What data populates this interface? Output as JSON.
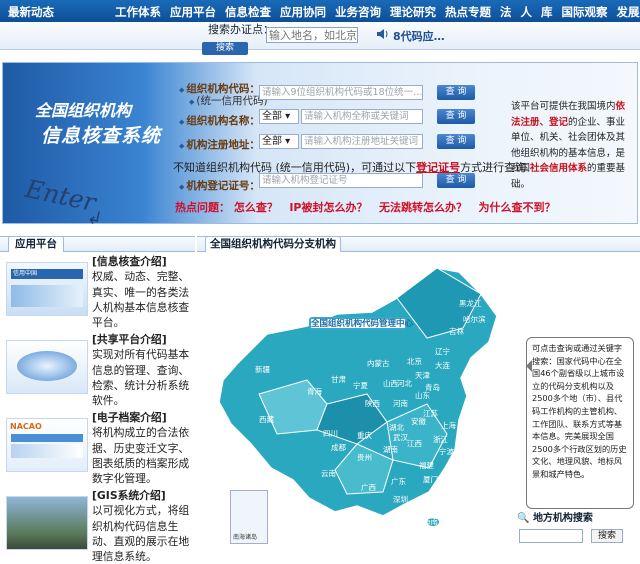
{
  "topnav": {
    "brand": "最新动态",
    "links": [
      "工作体系",
      "应用平台",
      "信息检查",
      "应用协同",
      "业务咨询",
      "理论研究",
      "热点专题",
      "法",
      "人",
      "库",
      "国际观察",
      "发展历程"
    ]
  },
  "notice": {
    "query_label": "搜索办证点：",
    "query_placeholder": "输入地名，如北京",
    "query_button": "搜索",
    "speaker_text": "8代码应…"
  },
  "banner": {
    "title_line1": "全国组织机构",
    "title_line2": "信息核查系统",
    "enter": "Enter",
    "code_label": "组织机构代码：",
    "code_label2": "(统一信用代码)",
    "code_placeholder": "请输入9位组织机构代码或18位统一…",
    "name_label": "组织机构名称：",
    "name_scope": "全部",
    "name_placeholder": "请输入机构全称或关键词",
    "addr_label": "机构注册地址：",
    "addr_scope": "全部",
    "addr_placeholder": "请输入机构注册地址关键词",
    "query_button": "查 询",
    "hint_prefix": "不知道组织机构代码 (统一信用代码)，可通过以下",
    "hint_link": "登记证号",
    "hint_suffix": "方式进行查询",
    "reg_label": "机构登记证号：",
    "reg_placeholder": "请输入机构登记证号",
    "hot_label": "热点问题：",
    "hot_items": [
      "怎么查？",
      "IP被封怎么办？",
      "无法跳转怎么办？",
      "为什么查不到？"
    ],
    "side_part1": "该平台可提供在我国境内",
    "side_red1": "依法注册、登记",
    "side_part2": "的企业、事业单位、机关、社会团体及其他组织机构的基本信息，是我国",
    "side_red2": "社会信用体系",
    "side_part3": "的重要基础。"
  },
  "left_panel": {
    "tab": "应用平台",
    "items": [
      {
        "title": "[信息核查介绍]",
        "body": "权威、动态、完整、真实、唯一的各类法人机构基本信息核查平台。",
        "thumb_text": "信用中国"
      },
      {
        "title": "[共享平台介绍]",
        "body": "实现对所有代码基本信息的管理、查询、检索、统计分析系统软件。",
        "thumb_text": ""
      },
      {
        "title": "[电子档案介绍]",
        "body": "将机构成立的合法依据、历史变迁文字、图表纸质的档案形成数字化管理。",
        "thumb_text": "NACAO"
      },
      {
        "title": "[GIS系统介绍]",
        "body": "以可视化方式，将组织机构代码信息生动、直观的展示在地理信息系统。",
        "thumb_text": ""
      }
    ]
  },
  "right_panel": {
    "tab": "全国组织机构代码分支机构",
    "center_label": "全国组织机构代码管理中心",
    "bubble": "可点击查询或通过关键字搜索：国家代码中心在全国46个副省级以上城市设立的代码分支机构以及2500多个地（市）、县代码工作机构的主管机构、工作团队、联系方式等基本信息。完美展现全国2500多个行政区划的历史文化、地理风貌、地标风景和城产特色。",
    "geo_search": "地方机构搜索",
    "geo_button": "搜索",
    "inset_label": "南海诸岛",
    "provinces": [
      "黑龙江",
      "吉林",
      "辽宁",
      "北京",
      "天津",
      "内蒙古",
      "新疆",
      "西藏",
      "青海",
      "甘肃",
      "宁夏",
      "陕西",
      "山西",
      "河北",
      "山东",
      "河南",
      "江苏",
      "安徽",
      "湖北",
      "重庆",
      "四川",
      "贵州",
      "云南",
      "湖南",
      "江西",
      "浙江",
      "上海",
      "福建",
      "广东",
      "广西",
      "海南",
      "台湾",
      "哈尔滨",
      "大连",
      "青岛",
      "宁波",
      "厦门",
      "深圳",
      "武汉",
      "成都"
    ]
  }
}
